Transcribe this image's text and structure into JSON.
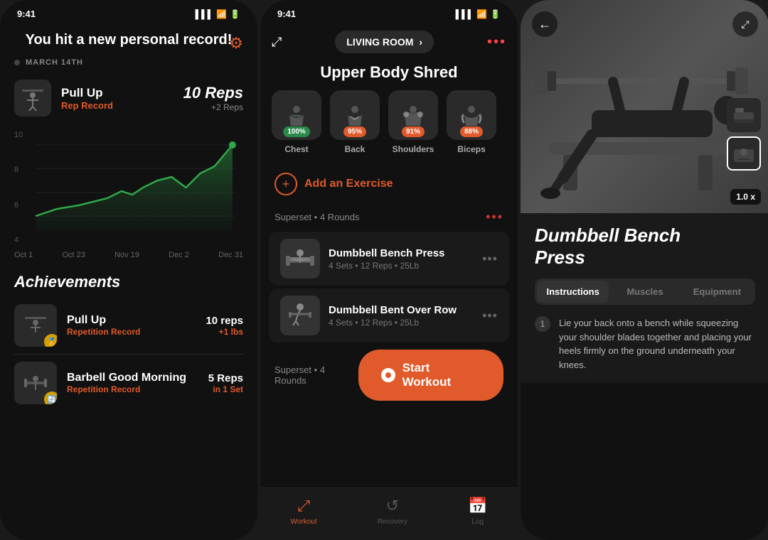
{
  "panel1": {
    "status_time": "9:41",
    "gear_icon": "⚙",
    "title": "You hit a new personal record!",
    "date_label": "MARCH 14TH",
    "exercise_name": "Pull Up",
    "exercise_type": "Rep Record",
    "record_value": "10",
    "record_unit": "Reps",
    "record_change": "+2 Reps",
    "chart_labels": [
      "Oct 1",
      "Oct 23",
      "Nov 19",
      "Dec 2",
      "Dec 31"
    ],
    "chart_y_labels": [
      "10",
      "8",
      "6",
      "4"
    ],
    "achievements_title": "Achievements",
    "achievements": [
      {
        "name": "Pull Up",
        "type": "Repetition Record",
        "reps": "10 reps",
        "change": "+1 lbs"
      },
      {
        "name": "Barbell Good Morning",
        "type": "Repetition Record",
        "reps": "5 Reps",
        "change": "in 1 Set"
      }
    ]
  },
  "panel2": {
    "status_time": "9:41",
    "location": "LIVING ROOM",
    "workout_title": "Upper Body Shred",
    "muscle_groups": [
      {
        "label": "Chest",
        "percent": "100%",
        "badge_type": "green"
      },
      {
        "label": "Back",
        "percent": "95%",
        "badge_type": "orange"
      },
      {
        "label": "Shoulders",
        "percent": "91%",
        "badge_type": "orange"
      },
      {
        "label": "Biceps",
        "percent": "88%",
        "badge_type": "orange"
      }
    ],
    "add_exercise_label": "Add an Exercise",
    "superset1_label": "Superset",
    "superset1_rounds": "4 Rounds",
    "exercises": [
      {
        "name": "Dumbbell Bench Press",
        "details": "4 Sets • 12 Reps • 25Lb"
      },
      {
        "name": "Dumbbell Bent Over Row",
        "details": "4 Sets • 12 Reps • 25Lb"
      }
    ],
    "superset2_label": "Superset",
    "superset2_rounds": "4 Rounds",
    "start_workout_label": "Start Workout",
    "nav": [
      {
        "label": "Workout",
        "active": true
      },
      {
        "label": "Recovery",
        "active": false
      },
      {
        "label": "Log",
        "active": false
      }
    ]
  },
  "panel3": {
    "status_time": "9:41",
    "back_icon": "←",
    "expand_icon": "⤢",
    "speed_label": "1.0 x",
    "exercise_title": "Dumbbell Bench\nPress",
    "tabs": [
      {
        "label": "Instructions",
        "active": true
      },
      {
        "label": "Muscles",
        "active": false
      },
      {
        "label": "Equipment",
        "active": false
      }
    ],
    "instruction_step": "1",
    "instruction_text": "Lie your back onto a bench while squeezing your shoulder blades together and placing your heels firmly on the ground underneath your knees."
  }
}
